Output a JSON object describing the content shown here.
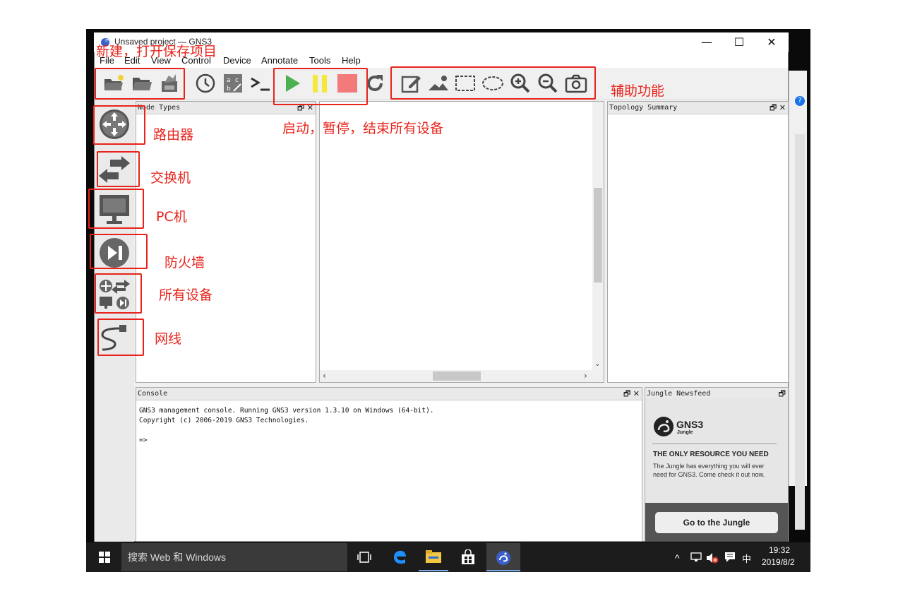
{
  "window": {
    "title": "Unsaved project — GNS3",
    "controls": [
      "—",
      "☐",
      "✕"
    ]
  },
  "menus": [
    "File",
    "Edit",
    "View",
    "Control",
    "Device",
    "Annotate",
    "Tools",
    "Help"
  ],
  "panels": {
    "node_types": "Node Types",
    "topology_summary": "Topology Summary",
    "console": "Console",
    "jungle_newsfeed": "Jungle Newsfeed",
    "panel_buttons": "🗗 ✕",
    "panel_float_button": "🗗"
  },
  "console": {
    "lines": [
      "GNS3 management console. Running GNS3 version 1.3.10 on Windows (64-bit).",
      "Copyright (c) 2006-2019 GNS3 Technologies.",
      "",
      "=>"
    ]
  },
  "jungle": {
    "logo_text": "GNS3",
    "logo_sub": "Jungle",
    "headline": "THE ONLY RESOURCE YOU NEED",
    "body": "The Jungle has everything you will ever need for GNS3. Come check it out now.",
    "button": "Go to the Jungle"
  },
  "annotations": {
    "file_ops": "新建，打开保存项目",
    "router": "路由器",
    "switch": "交换机",
    "pc": "PC机",
    "firewall": "防火墙",
    "all_devices": "所有设备",
    "cable": "网线",
    "start_pause_stop": "启动，暂停，结束所有设备",
    "aux": "辅助功能"
  },
  "taskbar": {
    "search_placeholder": "搜索 Web 和 Windows",
    "time": "19:32",
    "date": "2019/8/2",
    "ime": "中",
    "tray_chevron": "^"
  },
  "colors": {
    "annotation": "#e8231b",
    "play": "#4caf50",
    "pause": "#f5e83a",
    "stop": "#f27a7a"
  }
}
